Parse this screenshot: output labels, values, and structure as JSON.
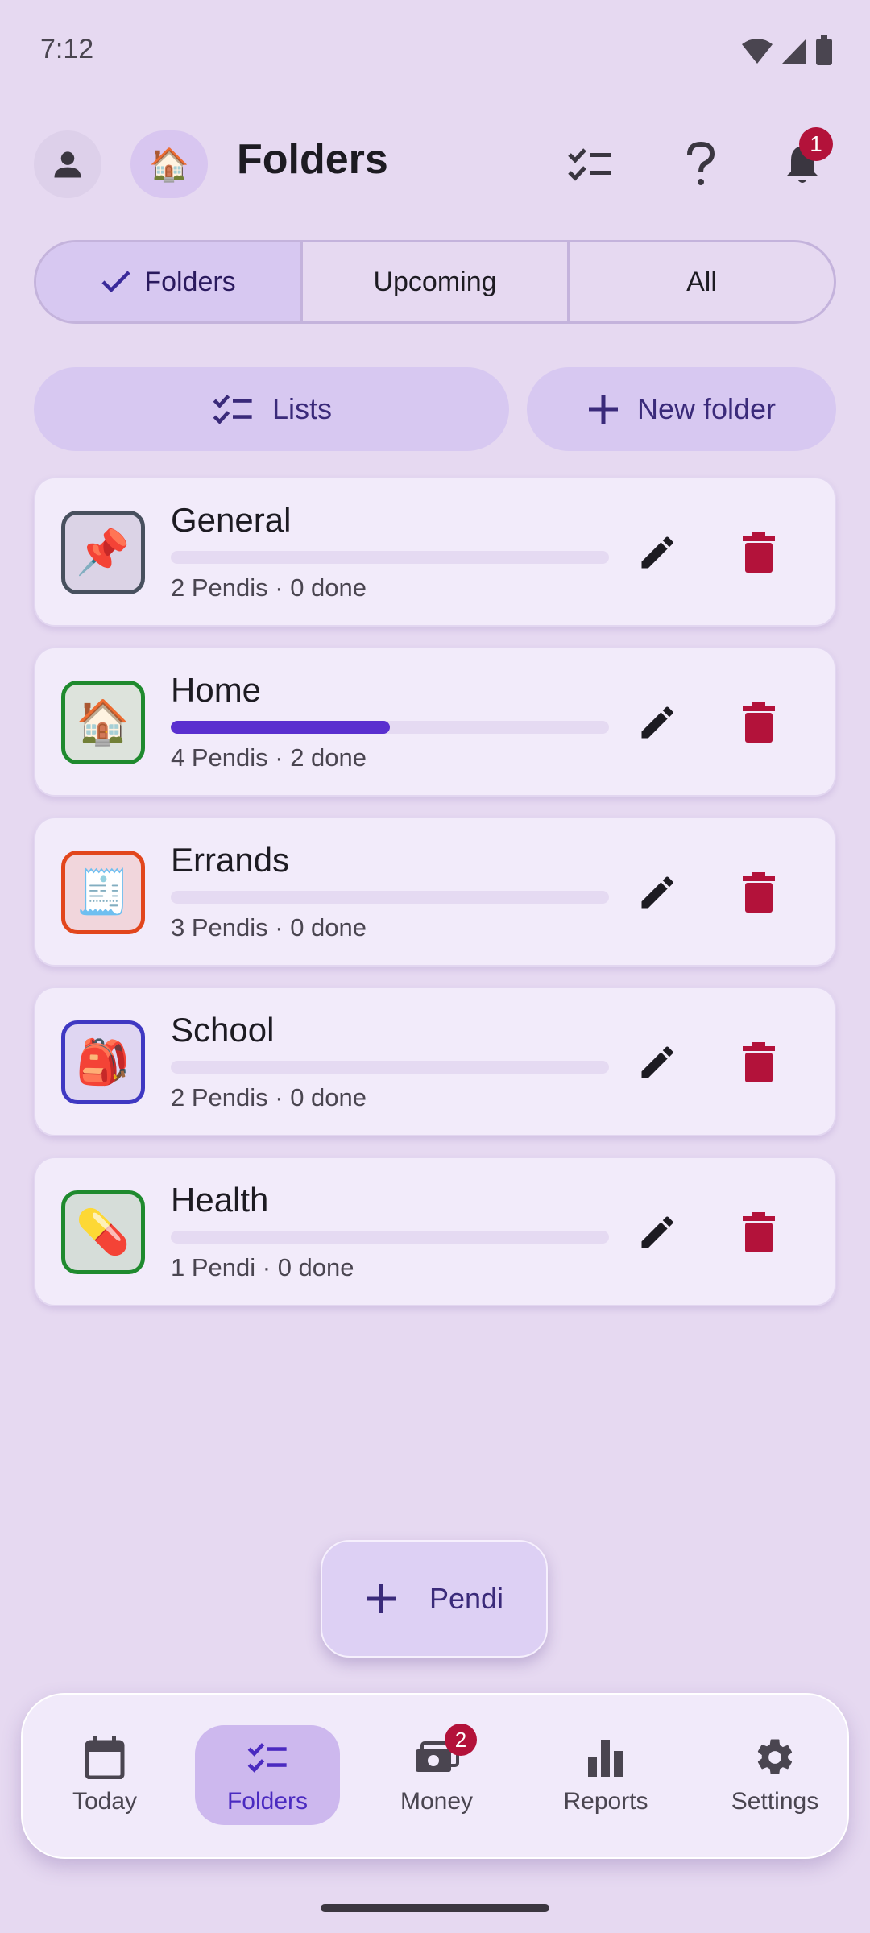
{
  "status_bar": {
    "time": "7:12"
  },
  "header": {
    "home_emoji": "🏠",
    "title": "Folders",
    "notification_count": "1"
  },
  "tabs": [
    {
      "label": "Folders",
      "selected": true
    },
    {
      "label": "Upcoming",
      "selected": false
    },
    {
      "label": "All",
      "selected": false
    }
  ],
  "actions": {
    "lists_label": "Lists",
    "new_folder_label": "New folder"
  },
  "folders": [
    {
      "name": "General",
      "emoji": "📌",
      "meta": "2 Pendis · 0 done",
      "progress": 0,
      "border_color": "#48505e",
      "bg_color": "#dbd3e6"
    },
    {
      "name": "Home",
      "emoji": "🏠",
      "meta": "4 Pendis · 2 done",
      "progress": 0.5,
      "border_color": "#1f8a2e",
      "bg_color": "#dde3dc"
    },
    {
      "name": "Errands",
      "emoji": "🧾",
      "meta": "3 Pendis · 0 done",
      "progress": 0,
      "border_color": "#e2461c",
      "bg_color": "#f1d6dc"
    },
    {
      "name": "School",
      "emoji": "🎒",
      "meta": "2 Pendis · 0 done",
      "progress": 0,
      "border_color": "#3f38c2",
      "bg_color": "#dfd6f2"
    },
    {
      "name": "Health",
      "emoji": "💊",
      "meta": "1 Pendi · 0 done",
      "progress": 0,
      "border_color": "#1f8a2e",
      "bg_color": "#d6ddd9"
    }
  ],
  "fab": {
    "label": "Pendi"
  },
  "bottom_nav": [
    {
      "label": "Today",
      "icon": "calendar-icon",
      "active": false
    },
    {
      "label": "Folders",
      "icon": "checklist-icon",
      "active": true
    },
    {
      "label": "Money",
      "icon": "money-icon",
      "active": false,
      "badge": "2"
    },
    {
      "label": "Reports",
      "icon": "bar-chart-icon",
      "active": false
    },
    {
      "label": "Settings",
      "icon": "gear-icon",
      "active": false
    }
  ],
  "colors": {
    "background": "#e6d9f1",
    "accent": "#5a2fcf",
    "delete": "#b3123a",
    "badge": "#b3123a"
  }
}
